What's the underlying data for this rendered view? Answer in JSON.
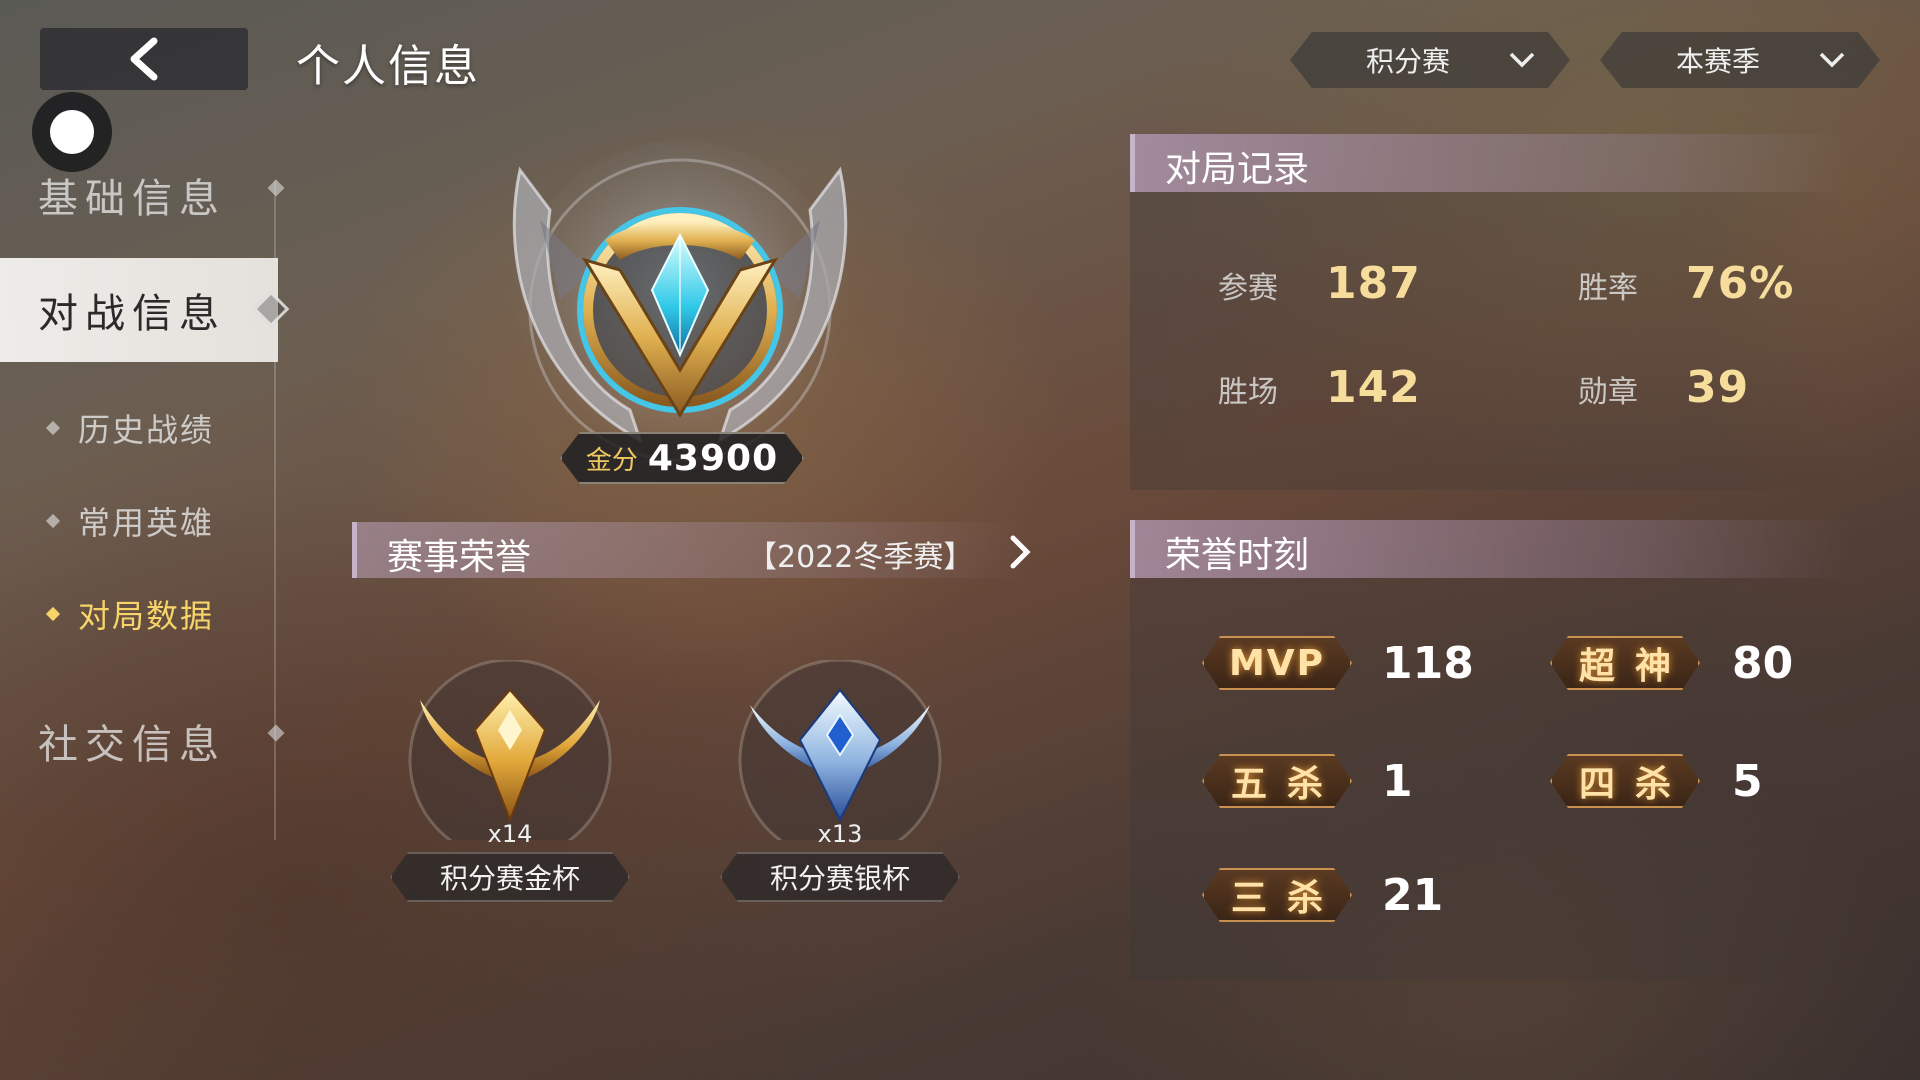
{
  "header": {
    "title": "个人信息",
    "mode_dropdown": "积分赛",
    "season_dropdown": "本赛季"
  },
  "sidebar": {
    "sections": [
      "基础信息",
      "对战信息",
      "社交信息"
    ],
    "active_section": "对战信息",
    "sub_items": [
      "历史战绩",
      "常用英雄",
      "对局数据"
    ],
    "active_sub_item": "对局数据",
    "active_color": "#f7d46a"
  },
  "rank": {
    "score_label": "金分",
    "score_value": "43900"
  },
  "honors": {
    "title": "赛事荣誉",
    "season": "【2022冬季赛】",
    "cups": [
      {
        "count": "x14",
        "name": "积分赛金杯",
        "color": "gold"
      },
      {
        "count": "x13",
        "name": "积分赛银杯",
        "color": "silver-blue"
      }
    ]
  },
  "match_record": {
    "title": "对局记录",
    "stats": [
      {
        "label": "参赛",
        "value": "187"
      },
      {
        "label": "胜率",
        "value": "76%"
      },
      {
        "label": "胜场",
        "value": "142"
      },
      {
        "label": "勋章",
        "value": "39"
      }
    ]
  },
  "honor_moments": {
    "title": "荣誉时刻",
    "items": [
      {
        "label": "MVP",
        "value": "118"
      },
      {
        "label": "超神",
        "value": "80"
      },
      {
        "label": "五杀",
        "value": "1"
      },
      {
        "label": "四杀",
        "value": "5"
      },
      {
        "label": "三杀",
        "value": "21"
      }
    ],
    "badge_color": "#c9914f"
  }
}
